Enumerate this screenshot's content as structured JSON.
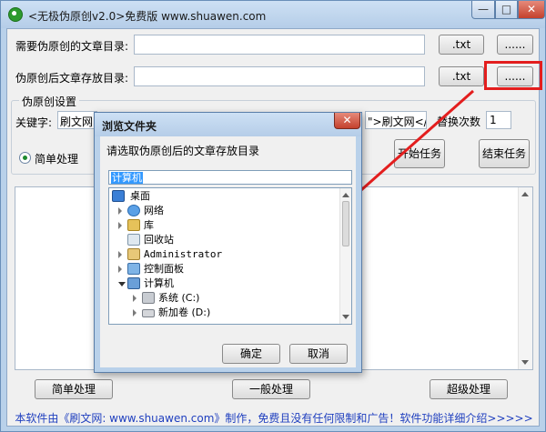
{
  "window": {
    "title": "<无极伪原创v2.0>免费版 www.shuawen.com",
    "controls": {
      "minimize": "—",
      "maximize": "□",
      "close": "✕"
    }
  },
  "form": {
    "source_label": "需要伪原创的文章目录:",
    "source_value": "",
    "source_ext": ".txt",
    "source_browse": "......",
    "output_label": "伪原创后文章存放目录:",
    "output_value": "",
    "output_ext": ".txt",
    "output_browse": "......"
  },
  "settings": {
    "group_title": "伪原创设置",
    "keyword_label": "关键字:",
    "keyword_value": "刷文网",
    "link_value": "\">刷文网</a>",
    "replace_label": "替换次数",
    "replace_value": "1",
    "mode_label": "简单处理",
    "start_button": "开始任务",
    "stop_button": "结束任务"
  },
  "log": {
    "text": ""
  },
  "buttons": {
    "simple": "简单处理",
    "normal": "一般处理",
    "advanced": "超级处理"
  },
  "footer": "本软件由《刷文网: www.shuawen.com》制作，免费且没有任何限制和广告！软件功能详细介绍>>>>>",
  "dialog": {
    "title": "浏览文件夹",
    "close": "✕",
    "prompt": "请选取伪原创后的文章存放目录",
    "selected": "计算机",
    "tree": [
      {
        "label": "桌面",
        "icon": "desktop-icon",
        "expander": "none"
      },
      {
        "label": "网络",
        "icon": "network-icon",
        "expander": "collapsed"
      },
      {
        "label": "库",
        "icon": "library-icon",
        "expander": "collapsed"
      },
      {
        "label": "回收站",
        "icon": "recycle-bin-icon",
        "expander": "none"
      },
      {
        "label": "Administrator",
        "icon": "user-folder-icon",
        "expander": "collapsed"
      },
      {
        "label": "控制面板",
        "icon": "control-panel-icon",
        "expander": "collapsed"
      },
      {
        "label": "计算机",
        "icon": "computer-icon",
        "expander": "expanded"
      },
      {
        "label": "系统 (C:)",
        "icon": "system-drive-icon",
        "expander": "collapsed"
      },
      {
        "label": "新加卷 (D:)",
        "icon": "drive-icon",
        "expander": "collapsed"
      }
    ],
    "ok": "确定",
    "cancel": "取消"
  },
  "colors": {
    "highlight": "#e31e1e",
    "footer_text": "#1f3fbf",
    "selection": "#3399ff"
  }
}
